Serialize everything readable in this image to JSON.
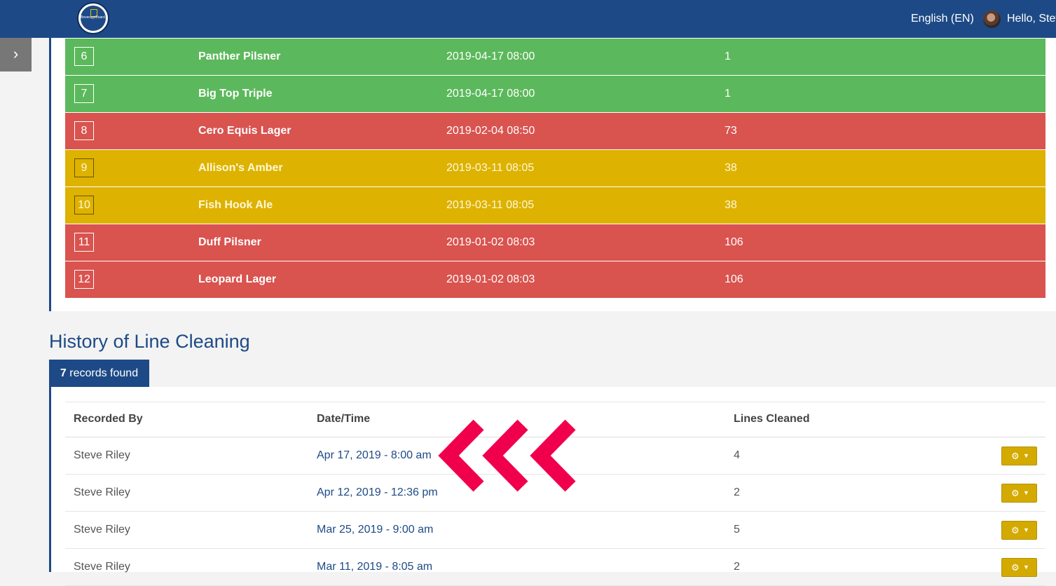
{
  "header": {
    "logo_icon": "brewery-logo",
    "logo_text": "BeverageBoard.com",
    "language": "English (EN)",
    "greeting": "Hello, Stev"
  },
  "sidebar_toggle_icon": "chevron-right-icon",
  "sidebar_toggle_glyph": "›",
  "colors": {
    "header": "#1d4a86",
    "row_green": "#5cb85c",
    "row_red": "#d9534f",
    "row_yellow": "#ddb200",
    "annotation_arrow": "#f0004c",
    "action_button": "#d4aa00"
  },
  "lines": [
    {
      "number": "6",
      "name": "Panther Pilsner",
      "last_cleaned": "2019-04-17 08:00",
      "days": "1",
      "status": "green"
    },
    {
      "number": "7",
      "name": "Big Top Triple",
      "last_cleaned": "2019-04-17 08:00",
      "days": "1",
      "status": "green"
    },
    {
      "number": "8",
      "name": "Cero Equis Lager",
      "last_cleaned": "2019-02-04 08:50",
      "days": "73",
      "status": "red"
    },
    {
      "number": "9",
      "name": "Allison's Amber",
      "last_cleaned": "2019-03-11 08:05",
      "days": "38",
      "status": "yellow"
    },
    {
      "number": "10",
      "name": "Fish Hook Ale",
      "last_cleaned": "2019-03-11 08:05",
      "days": "38",
      "status": "yellow"
    },
    {
      "number": "11",
      "name": "Duff Pilsner",
      "last_cleaned": "2019-01-02 08:03",
      "days": "106",
      "status": "red"
    },
    {
      "number": "12",
      "name": "Leopard Lager",
      "last_cleaned": "2019-01-02 08:03",
      "days": "106",
      "status": "red"
    }
  ],
  "history": {
    "title": "History of Line Cleaning",
    "records_count": "7",
    "records_label": "records found",
    "columns": [
      "Recorded By",
      "Date/Time",
      "Lines Cleaned"
    ],
    "rows": [
      {
        "recorded_by": "Steve Riley",
        "datetime": "Apr 17, 2019 - 8:00 am",
        "lines_cleaned": "4"
      },
      {
        "recorded_by": "Steve Riley",
        "datetime": "Apr 12, 2019 - 12:36 pm",
        "lines_cleaned": "2"
      },
      {
        "recorded_by": "Steve Riley",
        "datetime": "Mar 25, 2019 - 9:00 am",
        "lines_cleaned": "5"
      },
      {
        "recorded_by": "Steve Riley",
        "datetime": "Mar 11, 2019 - 8:05 am",
        "lines_cleaned": "2"
      }
    ],
    "action_icon": "gear-icon",
    "action_caret_icon": "caret-down-icon"
  },
  "annotation_icon": "triple-chevron-left-arrow"
}
